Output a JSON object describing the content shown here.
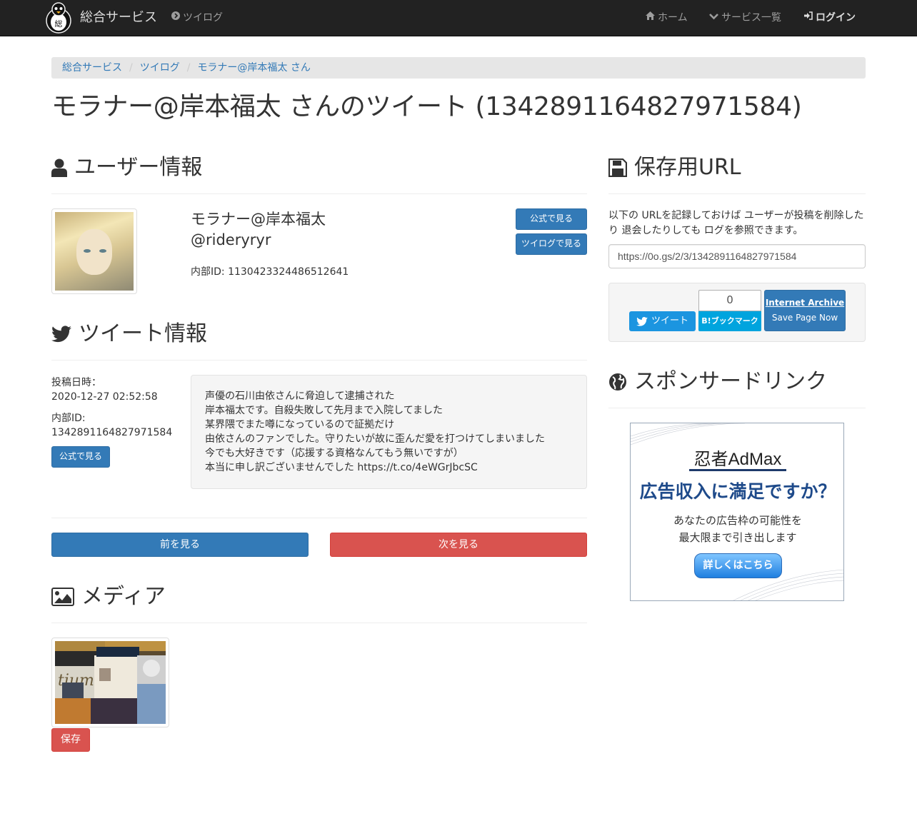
{
  "navbar": {
    "brand": "総合サービス",
    "tsuilog": "ツイログ",
    "home": "ホーム",
    "services": "サービス一覧",
    "login": "ログイン"
  },
  "breadcrumb": [
    "総合サービス",
    "ツイログ",
    "モラナー@岸本福太 さん"
  ],
  "page_title": "モラナー@岸本福太 さんのツイート (1342891164827971584)",
  "user_section": {
    "heading": "ユーザー情報",
    "display_name": "モラナー@岸本福太",
    "handle": "@rideryryr",
    "internal_id": "内部ID: 1130423324486512641",
    "btn_official": "公式で見る",
    "btn_tsuilog": "ツイログで見る"
  },
  "tweet_section": {
    "heading": "ツイート情報",
    "posted_label": "投稿日時：",
    "posted_at": "2020-12-27 02:52:58",
    "internal_label": "内部ID:",
    "internal_id": "1342891164827971584",
    "btn_official": "公式で見る",
    "text_lines": [
      "声優の石川由依さんに脅迫して逮捕された",
      "岸本福太です。自殺失敗して先月まで入院してました",
      "某界隈でまた噂になっているので証拠だけ",
      "由依さんのファンでした。守りたいが故に歪んだ愛を打つけてしまいました",
      "今でも大好きです（応援する資格なんてもう無いですが）",
      "本当に申し訳ございませんでした https://t.co/4eWGrJbcSC"
    ]
  },
  "pager": {
    "prev": "前を見る",
    "next": "次を見る"
  },
  "media_section": {
    "heading": "メディア",
    "save_btn": "保存"
  },
  "save_section": {
    "heading": "保存用URL",
    "description": "以下の URLを記録しておけば ユーザーが投稿を削除したり 退会したりしても ログを参照できます。",
    "url": "https://0o.gs/2/3/1342891164827971584"
  },
  "share": {
    "tweet": "ツイート",
    "hatena_count": "0",
    "hatena_label": "B!ブックマーク",
    "ia_title": "Internet Archive",
    "ia_sub": "Save Page Now"
  },
  "sponsor_section": {
    "heading": "スポンサードリンク",
    "ad_logo": "忍者AdMax",
    "ad_main": "広告収入に満足ですか？",
    "ad_sub_1": "あなたの広告枠の可能性を",
    "ad_sub_2": "最大限まで引き出します",
    "ad_btn": "詳しくはこちら"
  },
  "colors": {
    "navbar": "#222222",
    "primary": "#337ab7",
    "danger": "#d9534f",
    "twitter": "#1b95e0",
    "hatena": "#00a4de"
  }
}
